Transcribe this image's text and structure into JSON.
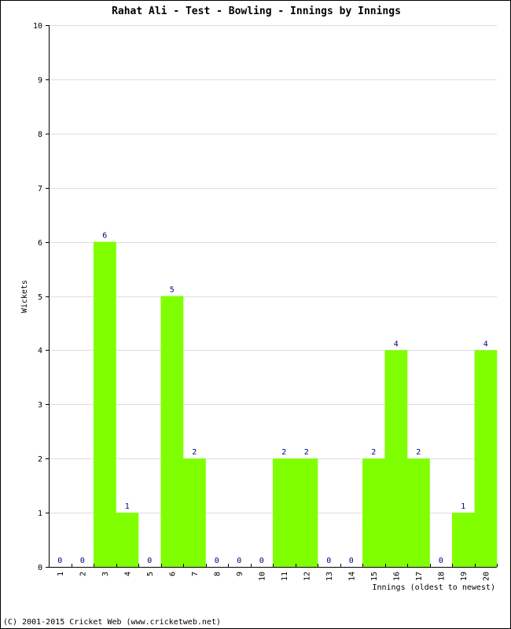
{
  "chart_data": {
    "type": "bar",
    "title": "Rahat Ali - Test - Bowling - Innings by Innings",
    "xlabel": "Innings (oldest to newest)",
    "ylabel": "Wickets",
    "ylim": [
      0,
      10
    ],
    "yticks": [
      0,
      1,
      2,
      3,
      4,
      5,
      6,
      7,
      8,
      9,
      10
    ],
    "grid": true,
    "bar_color": "#80ff00",
    "value_label_color": "#000080",
    "categories": [
      "1",
      "2",
      "3",
      "4",
      "5",
      "6",
      "7",
      "8",
      "9",
      "10",
      "11",
      "12",
      "13",
      "14",
      "15",
      "16",
      "17",
      "18",
      "19",
      "20"
    ],
    "values": [
      0,
      0,
      6,
      1,
      0,
      5,
      2,
      0,
      0,
      0,
      2,
      2,
      0,
      0,
      2,
      4,
      2,
      0,
      1,
      4
    ]
  },
  "footer": "(C) 2001-2015 Cricket Web (www.cricketweb.net)"
}
